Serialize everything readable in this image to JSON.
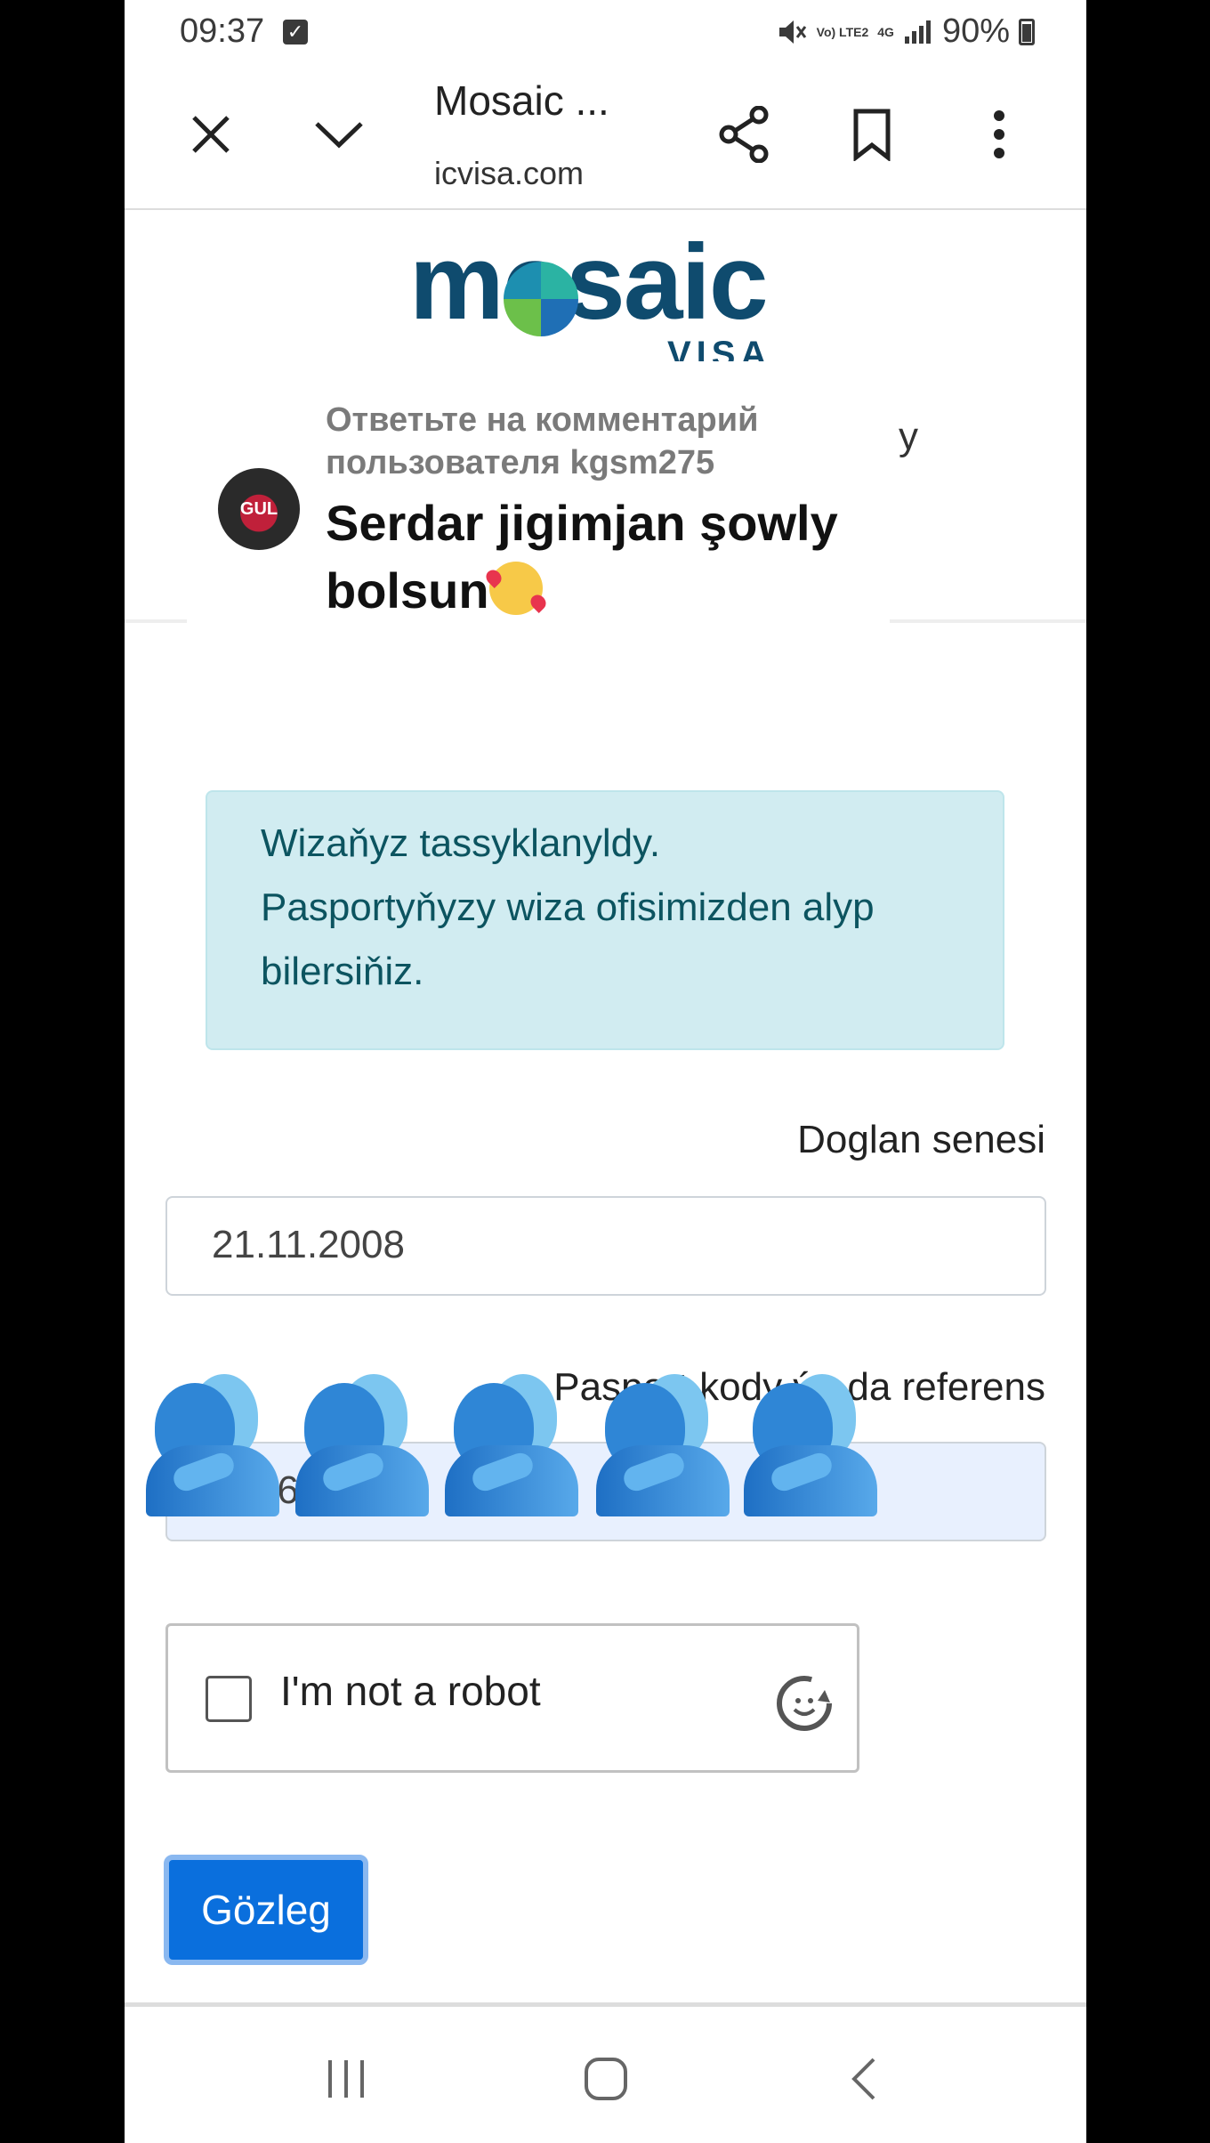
{
  "status_bar": {
    "time": "09:37",
    "network": "Vo) LTE2",
    "network_type": "4G",
    "battery": "90%"
  },
  "browser": {
    "title": "Mosaic ...",
    "url": "icvisa.com"
  },
  "site": {
    "logo_text": "mosaic",
    "logo_subtext": "VISA",
    "partial_text_behind": "y"
  },
  "comment": {
    "reply_to": "Ответьте на комментарий пользователя kgsm275",
    "text": "Serdar jigimjan şowly bolsun",
    "avatar_text": "GUL"
  },
  "alert": {
    "line1": "Wizaňyz tassyklanyldy.",
    "line2": "Pasportyňyzy wiza ofisimizden alyp bilersiňiz."
  },
  "form": {
    "dob_label": "Doglan senesi",
    "dob_value": "21.11.2008",
    "ref_label": "Pasport kody ýa-da referens",
    "ref_value": "M   06   78"
  },
  "captcha": {
    "label": "I'm not a robot"
  },
  "submit": {
    "label": "Gözleg"
  },
  "colors": {
    "accent": "#0a6fdd",
    "alert_bg": "#d1ecf1",
    "alert_text": "#0c5460",
    "brand": "#0f4b6e"
  }
}
